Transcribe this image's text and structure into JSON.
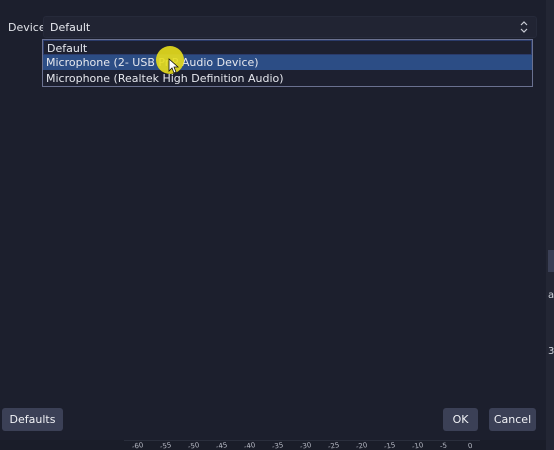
{
  "device": {
    "label": "Device",
    "selected_value": "Default",
    "options": [
      "Default",
      "Microphone (2- USB PnP Audio Device)",
      "Microphone (Realtek High Definition Audio)"
    ],
    "highlighted_index": 1
  },
  "buttons": {
    "defaults": "Defaults",
    "ok": "OK",
    "cancel": "Cancel"
  },
  "right_strip": {
    "mark_a": "a",
    "mark_3": "3"
  },
  "ruler_ticks": [
    "-60",
    "-55",
    "-50",
    "-45",
    "-40",
    "-35",
    "-30",
    "-25",
    "-20",
    "-15",
    "-10",
    "-5",
    "0"
  ],
  "colors": {
    "background": "#1c1f2d",
    "highlight": "#2c4d85",
    "button": "#3b4056",
    "cursor_halo": "#e8de1c"
  }
}
